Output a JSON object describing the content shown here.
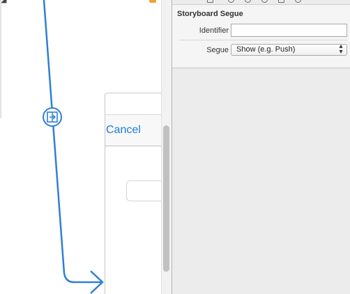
{
  "canvas": {
    "cancel_label": "Cancel",
    "segue_icon": "segue-badge-icon",
    "arrow_icon": "segue-arrowhead-icon"
  },
  "inspector": {
    "section_title": "Storyboard Segue",
    "identifier_label": "Identifier",
    "identifier_value": "",
    "segue_label": "Segue",
    "segue_value": "Show (e.g. Push)",
    "select_arrows": "▴▾"
  },
  "colors": {
    "segue_line": "#2f7fd4",
    "link_blue": "#1d7bd4",
    "inspector_bg": "#ececec"
  }
}
